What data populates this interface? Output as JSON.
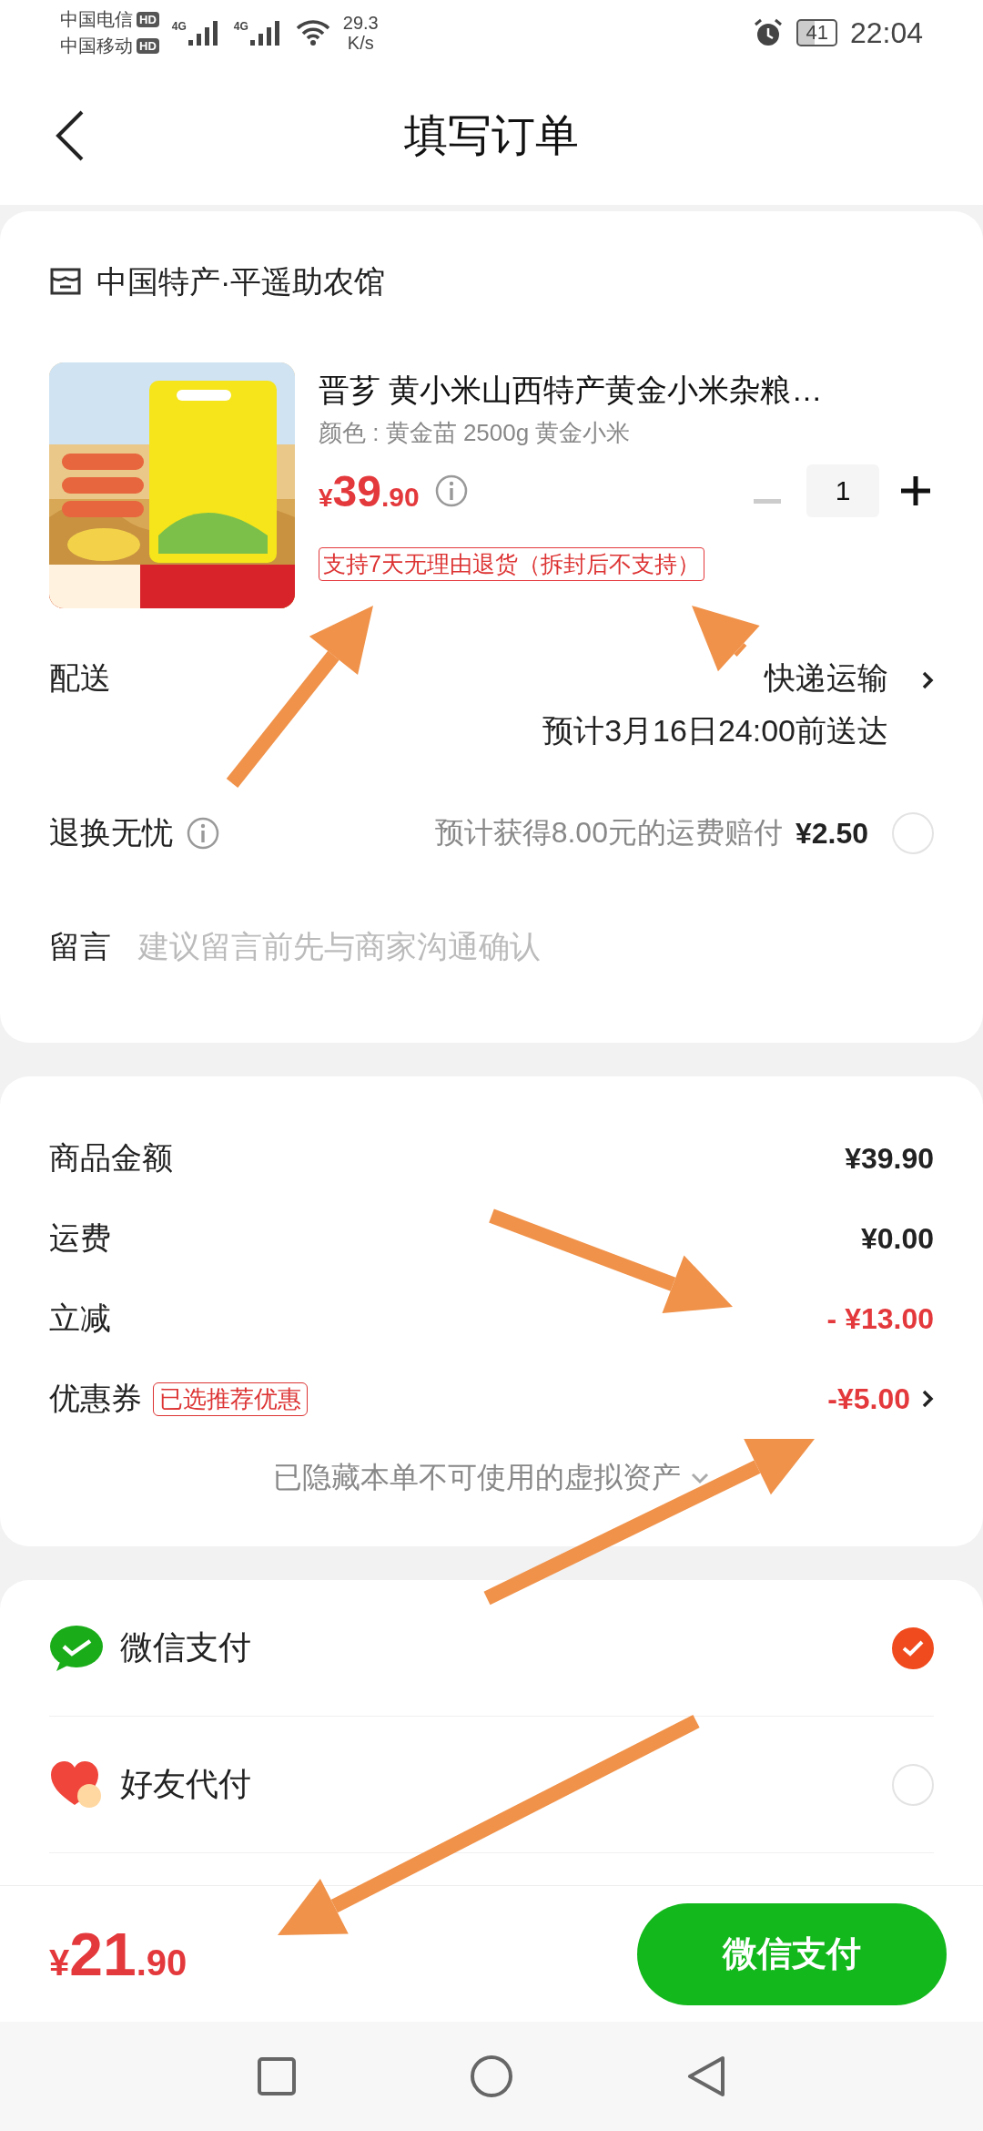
{
  "status_bar": {
    "carriers": [
      {
        "name": "中国电信",
        "badge": "HD"
      },
      {
        "name": "中国移动",
        "badge": "HD"
      }
    ],
    "signals": [
      {
        "label": "4G"
      },
      {
        "label": "4G"
      }
    ],
    "speed": "29.3",
    "speed_unit": "K/s",
    "battery": "41",
    "time": "22:04"
  },
  "header": {
    "title": "填写订单"
  },
  "shop": {
    "name": "中国特产·平遥助农馆"
  },
  "product": {
    "title": "晋芗 黄小米山西特产黄金小米杂粮…",
    "spec": "颜色 : 黄金苗 2500g 黄金小米",
    "price_symbol": "¥",
    "price_int": "39",
    "price_dec": ".90",
    "quantity": "1",
    "minus_disabled": true,
    "tag": "支持7天无理由退货（拆封后不支持）"
  },
  "delivery": {
    "label": "配送",
    "method": "快递运输",
    "eta": "预计3月16日24:00前送达"
  },
  "return_insurance": {
    "label": "退换无忧",
    "note": "预计获得8.00元的运费赔付",
    "price": "¥2.50",
    "checked": false
  },
  "message": {
    "label": "留言",
    "placeholder": "建议留言前先与商家沟通确认"
  },
  "summary": {
    "rows": [
      {
        "kind": "plain",
        "label": "商品金额",
        "value": "¥39.90"
      },
      {
        "kind": "plain",
        "label": "运费",
        "value": "¥0.00"
      },
      {
        "kind": "discount",
        "label": "立减",
        "value": "- ¥13.00"
      },
      {
        "kind": "coupon",
        "label": "优惠券",
        "badge": "已选推荐优惠",
        "value": "-¥5.00"
      }
    ],
    "hidden_note": "已隐藏本单不可使用的虚拟资产"
  },
  "payment_methods": [
    {
      "kind": "wechat",
      "label": "微信支付",
      "selected": true
    },
    {
      "kind": "friend",
      "label": "好友代付",
      "selected": false
    }
  ],
  "footer": {
    "currency": "¥",
    "amount_int": "21",
    "amount_dec": ".90",
    "pay_button": "微信支付"
  }
}
